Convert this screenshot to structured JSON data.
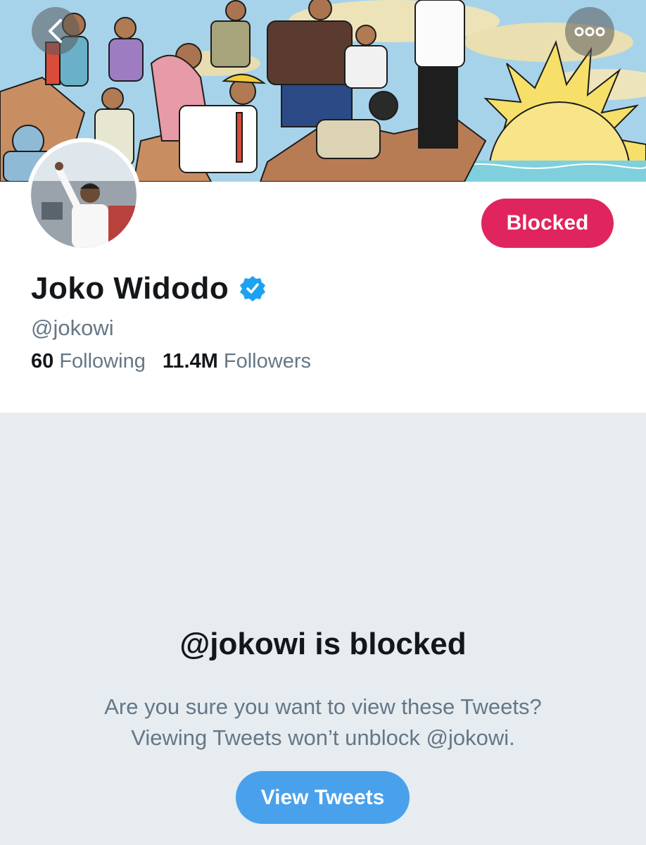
{
  "header": {
    "back_icon": "chevron-left-icon",
    "more_icon": "more-horizontal-icon"
  },
  "profile": {
    "display_name": "Joko Widodo",
    "verified": true,
    "handle": "@jokowi",
    "following_count": "60",
    "following_label": "Following",
    "followers_count": "11.4M",
    "followers_label": "Followers",
    "block_button_label": "Blocked"
  },
  "blocked_notice": {
    "title": "@jokowi is blocked",
    "line1": "Are you sure you want to view these Tweets?",
    "line2": "Viewing Tweets won’t unblock @jokowi.",
    "button_label": "View Tweets"
  },
  "colors": {
    "blocked_red": "#e0245e",
    "twitter_blue": "#4aa1eb",
    "secondary_text": "#657786",
    "page_background": "#e6ecf0"
  }
}
